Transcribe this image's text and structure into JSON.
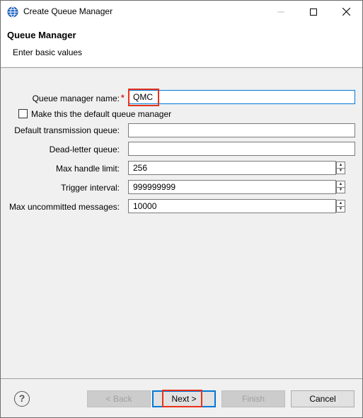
{
  "window": {
    "title": "Create Queue Manager",
    "minimize_label": "—",
    "maximize_label": "☐",
    "close_label": "✕"
  },
  "banner": {
    "title": "Queue Manager",
    "subtitle": "Enter basic values"
  },
  "form": {
    "qm_name": {
      "label": "Queue manager name:",
      "required_marker": "*",
      "value": "QMC"
    },
    "default_qm": {
      "label": "Make this the default queue manager",
      "checked": false
    },
    "xmit_queue": {
      "label": "Default transmission queue:",
      "value": ""
    },
    "dlq": {
      "label": "Dead-letter queue:",
      "value": ""
    },
    "max_handle": {
      "label": "Max handle limit:",
      "value": "256"
    },
    "trigger_interval": {
      "label": "Trigger interval:",
      "value": "999999999"
    },
    "max_uncommitted": {
      "label": "Max uncommitted messages:",
      "value": "10000"
    }
  },
  "buttons": {
    "help": "?",
    "back": "< Back",
    "next": "Next >",
    "finish": "Finish",
    "cancel": "Cancel"
  },
  "colors": {
    "highlight": "#e8321c",
    "required": "#e02020",
    "focus": "#0078d7"
  }
}
